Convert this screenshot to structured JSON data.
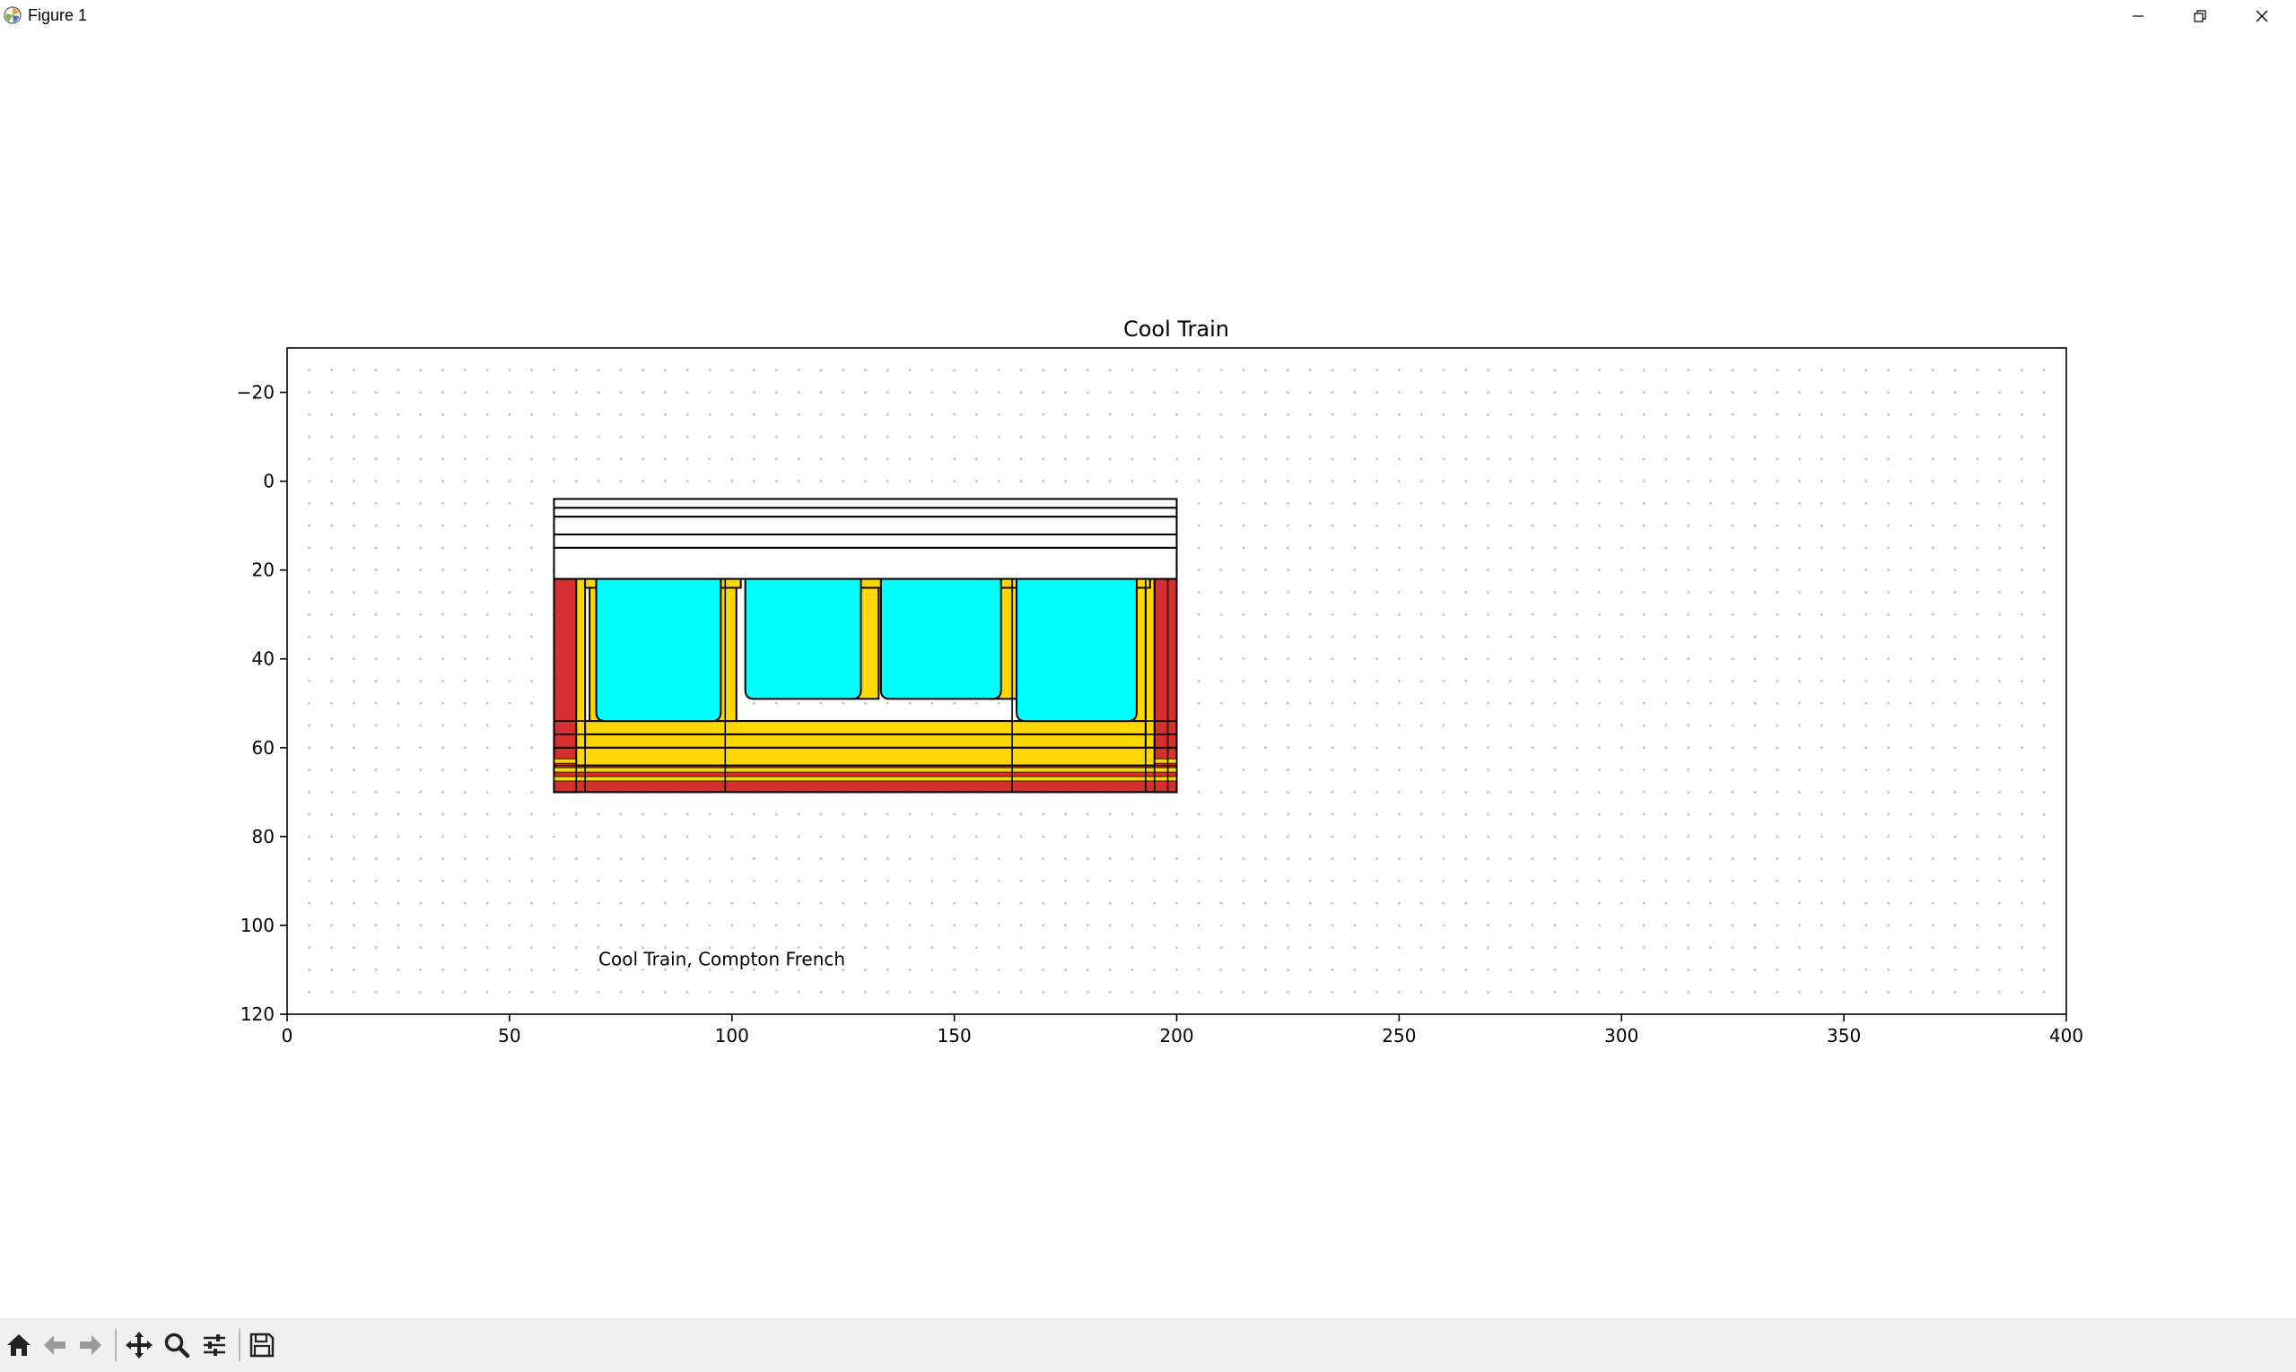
{
  "window": {
    "title": "Figure 1",
    "icon": "matplotlib-icon",
    "controls": [
      "minimize-icon",
      "restore-icon",
      "close-icon"
    ]
  },
  "figure": {
    "note": "Cool Train, Compton French",
    "note_pos": [
      70,
      109
    ]
  },
  "toolbar": {
    "buttons": [
      "home-icon",
      "back-icon",
      "forward-icon",
      "pan-icon",
      "zoom-icon",
      "configure-subplots-icon",
      "save-icon"
    ]
  },
  "colors": {
    "body_red": "#d62f2f",
    "trim_yellow": "#ffd700",
    "window_cyan": "#00ffff",
    "roof_white": "#ffffff",
    "outline": "#000000",
    "grid_dots": "#c8c8c8",
    "toolbar_bg": "#f0f0f0"
  },
  "chart_data": {
    "type": "other",
    "title": "Cool Train",
    "xlabel": "",
    "ylabel": "",
    "xlim": [
      0,
      400
    ],
    "ylim": [
      120,
      -30
    ],
    "y_inverted": true,
    "x_ticks": [
      0,
      50,
      100,
      150,
      200,
      250,
      300,
      350,
      400
    ],
    "x_tick_labels": [
      "0",
      "50",
      "100",
      "150",
      "200",
      "250",
      "300",
      "350",
      "400"
    ],
    "y_ticks": [
      -20,
      0,
      20,
      40,
      60,
      80,
      100,
      120
    ],
    "y_tick_labels": [
      "−20",
      "0",
      "20",
      "40",
      "60",
      "80",
      "100",
      "120"
    ],
    "grid": "dotted every 5 units",
    "shapes": {
      "roof_stripes": [
        [
          60,
          4,
          140,
          2
        ],
        [
          60,
          6,
          140,
          2
        ],
        [
          60,
          8,
          140,
          4
        ],
        [
          60,
          12,
          140,
          3
        ],
        [
          60,
          15,
          140,
          7
        ]
      ],
      "body_panels": [
        [
          60,
          22,
          5,
          48
        ],
        [
          195,
          22,
          5,
          48
        ]
      ],
      "yellow_frame": [
        [
          65,
          22,
          2,
          38
        ],
        [
          193,
          22,
          2,
          38
        ],
        [
          67,
          54,
          126,
          3
        ],
        [
          67,
          57,
          126,
          3
        ],
        [
          65,
          60,
          130,
          4
        ]
      ],
      "pillars": [
        [
          68,
          22,
          3,
          32
        ],
        [
          95,
          22,
          6,
          32
        ],
        [
          127,
          22,
          6,
          27
        ],
        [
          158,
          22,
          6,
          27
        ],
        [
          190,
          22,
          3,
          32
        ]
      ],
      "windows": [
        [
          69.5,
          22,
          28,
          32
        ],
        [
          103,
          22,
          26,
          27
        ],
        [
          133.5,
          22,
          27,
          27
        ],
        [
          164,
          22,
          27,
          32
        ]
      ],
      "lower_red": [
        60,
        60,
        140,
        10
      ],
      "lower_stripes": [
        [
          60,
          62.5,
          140,
          1
        ],
        [
          60,
          64.5,
          140,
          1
        ],
        [
          60,
          66.5,
          140,
          1
        ]
      ],
      "verticals": [
        60,
        65,
        67,
        98.5,
        163,
        193,
        195,
        198,
        200
      ]
    }
  }
}
